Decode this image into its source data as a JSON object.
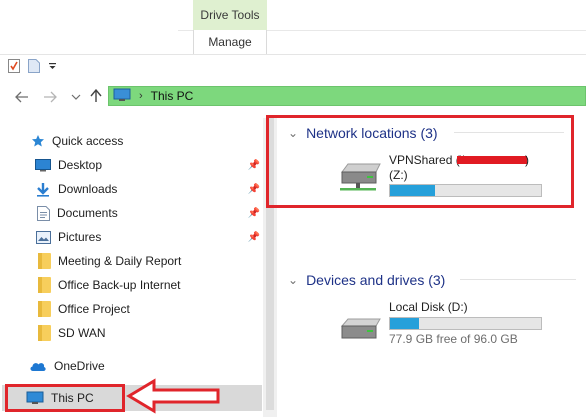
{
  "ribbon": {
    "contextual_tab": "Drive Tools",
    "manage_tab": "Manage"
  },
  "address": {
    "path": "This PC"
  },
  "sidebar": {
    "quick_access": "Quick access",
    "items": [
      {
        "label": "Desktop",
        "icon": "desktop-icon",
        "pinned": true
      },
      {
        "label": "Downloads",
        "icon": "download-arrow-icon",
        "pinned": true
      },
      {
        "label": "Documents",
        "icon": "documents-icon",
        "pinned": true
      },
      {
        "label": "Pictures",
        "icon": "pictures-icon",
        "pinned": true
      },
      {
        "label": "Meeting & Daily Report",
        "icon": "folder-icon",
        "pinned": false
      },
      {
        "label": "Office Back-up Internet",
        "icon": "folder-icon",
        "pinned": false
      },
      {
        "label": "Office Project",
        "icon": "folder-icon",
        "pinned": false
      },
      {
        "label": "SD WAN",
        "icon": "folder-icon",
        "pinned": false
      }
    ],
    "onedrive": "OneDrive",
    "this_pc": "This PC"
  },
  "main": {
    "network_header": "Network locations (3)",
    "devices_header": "Devices and drives (3)",
    "network_drive": {
      "name": "VPNShared (\\\\",
      "name_suffix": ")",
      "letter": "(Z:)",
      "used_fraction": 0.3
    },
    "local_disk": {
      "name": "Local Disk (D:)",
      "free_text": "77.9 GB free of 96.0 GB",
      "used_fraction": 0.19
    }
  },
  "colors": {
    "address_bar": "#7dd87d",
    "annotation_red": "#e0252b",
    "progress_blue": "#26a0da",
    "contextual_tab": "#dff0d0"
  }
}
